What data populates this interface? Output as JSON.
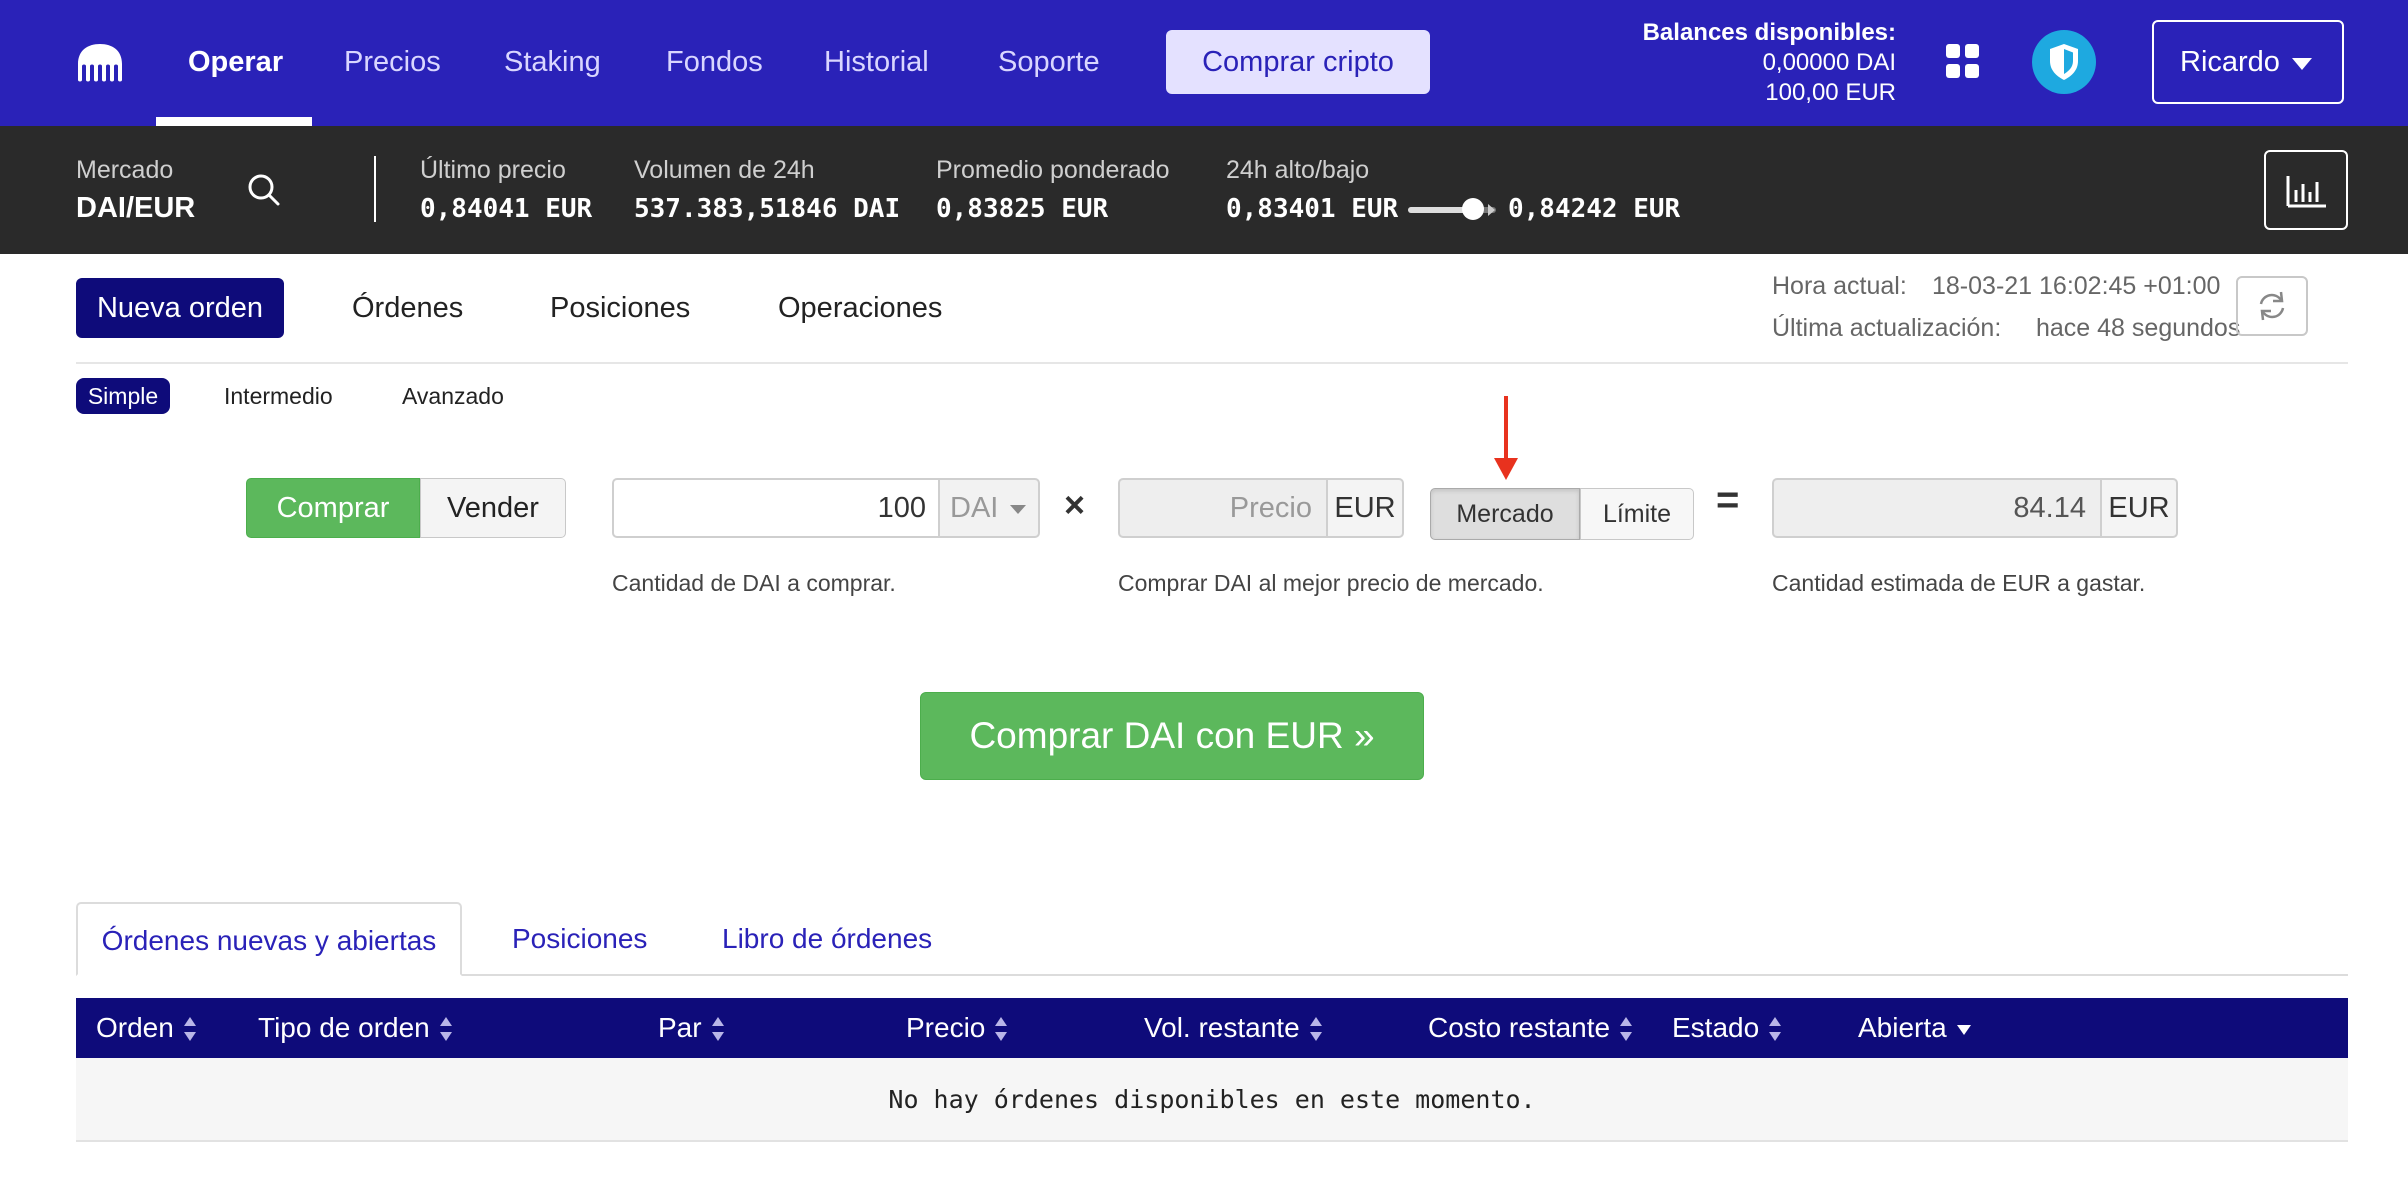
{
  "nav": {
    "items": [
      "Operar",
      "Precios",
      "Staking",
      "Fondos",
      "Historial",
      "Soporte"
    ],
    "active_index": 0,
    "buy_crypto": "Comprar cripto",
    "balances_title": "Balances disponibles:",
    "balance_dai": "0,00000 DAI",
    "balance_eur": "100,00 EUR",
    "user": "Ricardo",
    "accent_color": "#2a22b8"
  },
  "market": {
    "market_label": "Mercado",
    "pair": "DAI/EUR",
    "last_price_label": "Último precio",
    "last_price": "0,84041 EUR",
    "volume_label": "Volumen de 24h",
    "volume": "537.383,51846 DAI",
    "vwap_label": "Promedio ponderado",
    "vwap": "0,83825 EUR",
    "highlow_label": "24h alto/bajo",
    "low": "0,83401 EUR",
    "high": "0,84242 EUR"
  },
  "order_tabs": {
    "items": [
      "Nueva orden",
      "Órdenes",
      "Posiciones",
      "Operaciones"
    ],
    "active_index": 0,
    "current_time_label": "Hora actual:",
    "current_time": "18-03-21 16:02:45 +01:00",
    "last_update_label": "Última actualización:",
    "last_update": "hace 48 segundos"
  },
  "modes": {
    "items": [
      "Simple",
      "Intermedio",
      "Avanzado"
    ],
    "active_index": 0
  },
  "form": {
    "buy": "Comprar",
    "sell": "Vender",
    "amount_value": "100",
    "amount_unit": "DAI",
    "amount_hint": "Cantidad de DAI a comprar.",
    "times_symbol": "×",
    "price_placeholder": "Precio",
    "price_unit": "EUR",
    "price_hint": "Comprar DAI al mejor precio de mercado.",
    "type_market": "Mercado",
    "type_limit": "Límite",
    "equals_symbol": "=",
    "total_value": "84.14",
    "total_unit": "EUR",
    "total_hint": "Cantidad estimada de EUR a gastar.",
    "submit": "Comprar DAI con EUR »",
    "buy_color": "#5cb85c",
    "annotation_arrow_color": "#e8321e"
  },
  "lower_tabs": {
    "items": [
      "Órdenes nuevas y abiertas",
      "Posiciones",
      "Libro de órdenes"
    ],
    "active_index": 0
  },
  "table": {
    "headers": [
      "Orden",
      "Tipo de orden",
      "Par",
      "Precio",
      "Vol. restante",
      "Costo restante",
      "Estado",
      "Abierta"
    ],
    "empty_message": "No hay órdenes disponibles en este momento."
  },
  "icons": {
    "logo": "kraken-logo-icon",
    "search": "search-icon",
    "grid": "grid-icon",
    "shield": "shield-icon",
    "chart": "bar-chart-icon",
    "refresh": "refresh-icon"
  }
}
